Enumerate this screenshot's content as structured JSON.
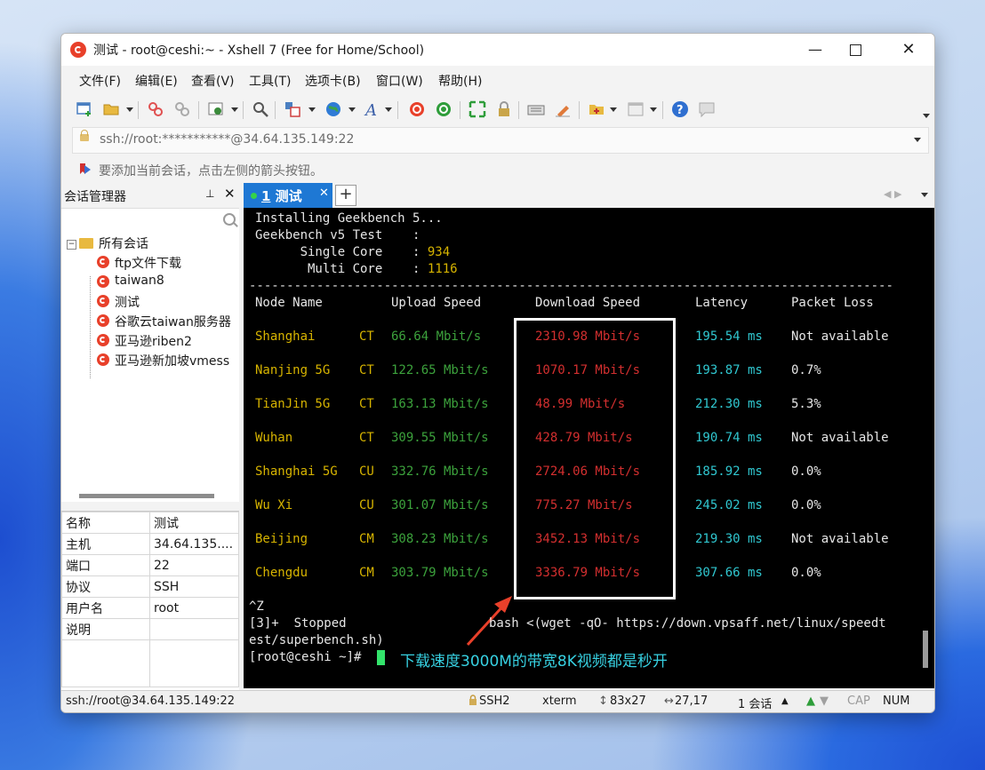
{
  "window": {
    "title": "测试 - root@ceshi:~ - Xshell 7 (Free for Home/School)",
    "minimize": "—",
    "close": "✕"
  },
  "menu": [
    "文件(F)",
    "编辑(E)",
    "查看(V)",
    "工具(T)",
    "选项卡(B)",
    "窗口(W)",
    "帮助(H)"
  ],
  "address": {
    "value": "ssh://root:***********@34.64.135.149:22"
  },
  "hint": {
    "text": "要添加当前会话，点击左侧的箭头按钮。"
  },
  "session_manager": {
    "title": "会话管理器",
    "pin": "⊥",
    "close": "✕",
    "root": "所有会话",
    "expand": "−",
    "items": [
      "ftp文件下载",
      "taiwan8",
      "测试",
      "谷歌云taiwan服务器",
      "亚马逊riben2",
      "亚马逊新加坡vmess"
    ]
  },
  "properties": [
    {
      "key": "名称",
      "value": "测试"
    },
    {
      "key": "主机",
      "value": "34.64.135...."
    },
    {
      "key": "端口",
      "value": "22"
    },
    {
      "key": "协议",
      "value": "SSH"
    },
    {
      "key": "用户名",
      "value": "root"
    },
    {
      "key": "说明",
      "value": ""
    }
  ],
  "tab": {
    "num": "1",
    "label": "测试",
    "close": "✕",
    "add": "+",
    "nav": "◀ ▶"
  },
  "terminal": {
    "line1": "Installing Geekbench 5...",
    "line2": "Geekbench v5 Test    :",
    "single_label": "      Single Core    : ",
    "single_value": "934",
    "multi_label": "       Multi Core    : ",
    "multi_value": "1116",
    "dashes": "--------------------------------------------------------------------------------------",
    "headers": {
      "node": "Node Name",
      "upload": "Upload Speed",
      "download": "Download Speed",
      "latency": "Latency",
      "loss": "Packet Loss"
    },
    "rows": [
      {
        "node": "Shanghai",
        "isp": "CT",
        "upload": "66.64 Mbit/s",
        "download": "2310.98 Mbit/s",
        "latency": "195.54 ms",
        "loss": "Not available"
      },
      {
        "node": "Nanjing 5G",
        "isp": "CT",
        "upload": "122.65 Mbit/s",
        "download": "1070.17 Mbit/s",
        "latency": "193.87 ms",
        "loss": "0.7%"
      },
      {
        "node": "TianJin 5G",
        "isp": "CT",
        "upload": "163.13 Mbit/s",
        "download": "48.99 Mbit/s",
        "latency": "212.30 ms",
        "loss": "5.3%"
      },
      {
        "node": "Wuhan",
        "isp": "CT",
        "upload": "309.55 Mbit/s",
        "download": "428.79 Mbit/s",
        "latency": "190.74 ms",
        "loss": "Not available"
      },
      {
        "node": "Shanghai 5G",
        "isp": "CU",
        "upload": "332.76 Mbit/s",
        "download": "2724.06 Mbit/s",
        "latency": "185.92 ms",
        "loss": "0.0%"
      },
      {
        "node": "Wu Xi",
        "isp": "CU",
        "upload": "301.07 Mbit/s",
        "download": "775.27 Mbit/s",
        "latency": "245.02 ms",
        "loss": "0.0%"
      },
      {
        "node": "Beijing",
        "isp": "CM",
        "upload": "308.23 Mbit/s",
        "download": "3452.13 Mbit/s",
        "latency": "219.30 ms",
        "loss": "Not available"
      },
      {
        "node": "Chengdu",
        "isp": "CM",
        "upload": "303.79 Mbit/s",
        "download": "3336.79 Mbit/s",
        "latency": "307.66 ms",
        "loss": "0.0%"
      }
    ],
    "ctrlz": "^Z",
    "stopped_a": "[3]+  Stopped",
    "stopped_b": "bash <(wget -qO- https://down.vpsaff.net/linux/speedt",
    "stopped_c": "est/superbench.sh)",
    "prompt": "[root@ceshi ~]# ",
    "annotation": "下载速度3000M的带宽8K视频都是秒开"
  },
  "status": {
    "conn": "ssh://root@34.64.135.149:22",
    "proto": "SSH2",
    "term": "xterm",
    "size": "83x27",
    "pos": "27,17",
    "sessions": "1 会话",
    "cap": "CAP",
    "num": "NUM"
  },
  "colors": {
    "tab_active": "#1e78d4",
    "node_yellow": "#d7b400",
    "upload_green": "#3ca23c",
    "download_red": "#d32f2f",
    "latency_cyan": "#30c7d0"
  }
}
